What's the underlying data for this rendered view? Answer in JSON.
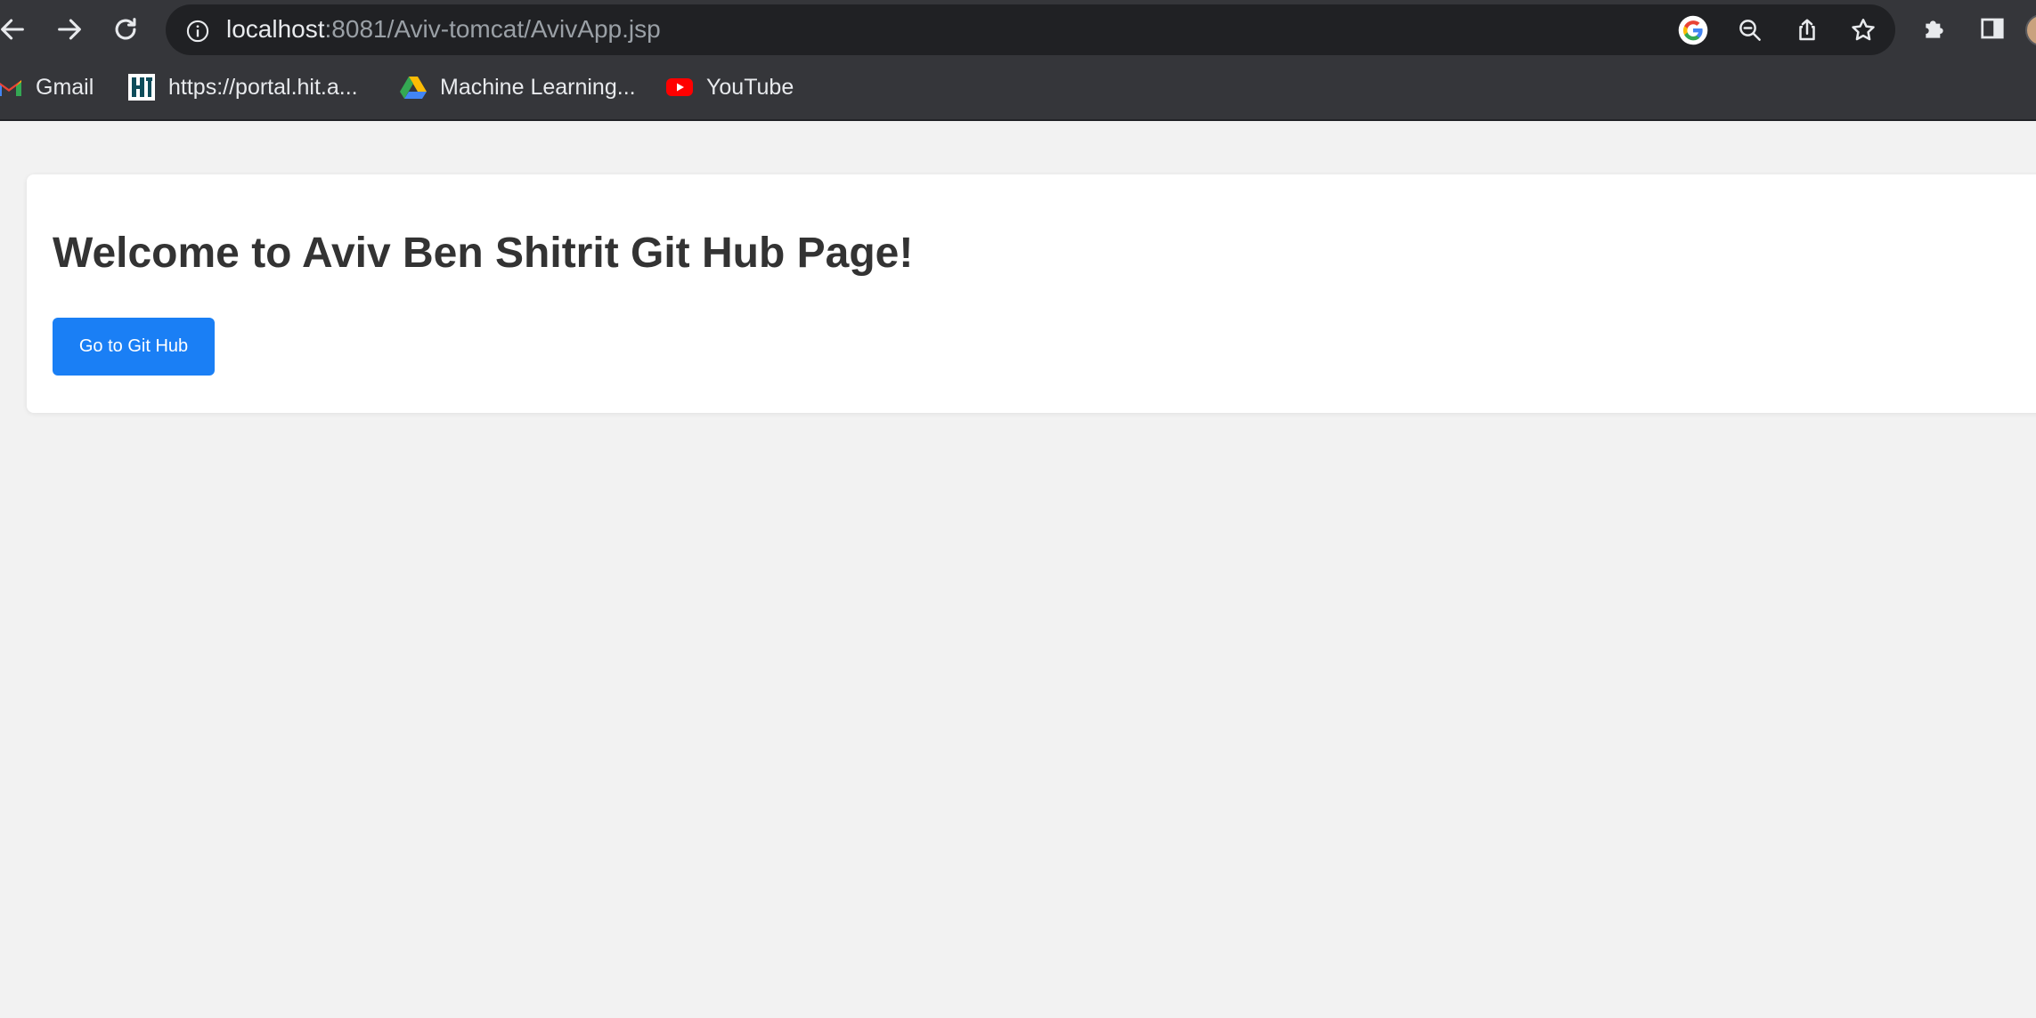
{
  "browser": {
    "url": {
      "host": "localhost",
      "rest": ":8081/Aviv-tomcat/AvivApp.jsp"
    },
    "nav_icons": [
      "back-icon",
      "forward-icon",
      "reload-icon"
    ],
    "omnibox_icons": [
      "info-icon",
      "google-icon",
      "zoom-out-icon",
      "share-icon",
      "star-icon"
    ],
    "toolbar_icons": [
      "extensions-icon",
      "side-panel-icon",
      "profile-avatar"
    ],
    "bookmarks": [
      {
        "label": "Gmail",
        "icon": "gmail-icon"
      },
      {
        "label": "https://portal.hit.a...",
        "icon": "hit-icon"
      },
      {
        "label": "Machine Learning...",
        "icon": "google-drive-icon"
      },
      {
        "label": "YouTube",
        "icon": "youtube-icon"
      }
    ],
    "colors": {
      "toolbar_bg": "#35363a",
      "omnibox_bg": "#202124",
      "text": "#e8eaed"
    }
  },
  "page": {
    "title": "Welcome to Aviv Ben Shitrit Git Hub Page!",
    "button_label": "Go to Git Hub",
    "colors": {
      "background": "#f2f2f2",
      "card": "#ffffff",
      "heading": "#333333",
      "button": "#1a7ff5"
    }
  }
}
